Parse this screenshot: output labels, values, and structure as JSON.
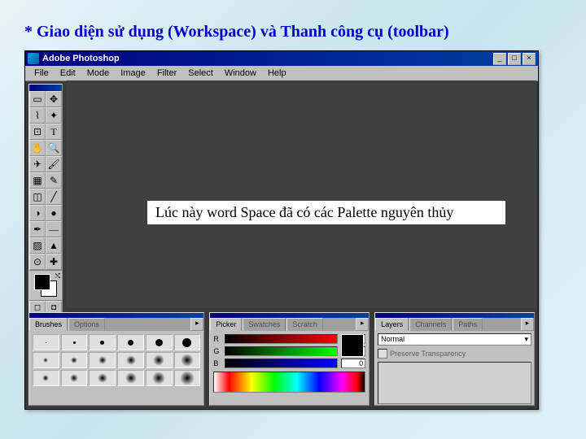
{
  "slide": {
    "title": "* Giao diện sử dụng (Workspace) và Thanh công cụ (toolbar)"
  },
  "app": {
    "title": "Adobe Photoshop",
    "menu": [
      "File",
      "Edit",
      "Mode",
      "Image",
      "Filter",
      "Select",
      "Window",
      "Help"
    ],
    "callout": "Lúc này word Space đã có các Palette nguyên thủy"
  },
  "titlebar_buttons": {
    "min": "_",
    "max": "□",
    "close": "×"
  },
  "tools": [
    "marquee",
    "move",
    "lasso",
    "wand",
    "crop",
    "type",
    "hand",
    "zoom",
    "airbrush",
    "brush",
    "stamp",
    "pencil",
    "eraser",
    "line",
    "blur",
    "dodge",
    "pen",
    "measure",
    "gradient",
    "bucket",
    "eyedropper",
    "notes"
  ],
  "tool_glyphs": [
    "▭",
    "✥",
    "⌇",
    "✦",
    "⊡",
    "T",
    "✋",
    "🔍",
    "✈",
    "🖌",
    "▦",
    "✎",
    "◫",
    "╱",
    "◑",
    "●",
    "✒",
    "—",
    "▨",
    "▲",
    "⊙",
    "✚"
  ],
  "modes": {
    "std": "◻",
    "qmask": "◘",
    "screen1": "▭",
    "screen2": "▣"
  },
  "panels": {
    "brushes": {
      "tabs": [
        "Brushes",
        "Options"
      ],
      "sizes_hard": [
        1,
        3,
        5,
        7,
        9,
        11
      ],
      "sizes_soft": [
        6,
        8,
        10,
        12,
        14,
        16
      ],
      "sizes_soft2": [
        8,
        10,
        12,
        14,
        16,
        18
      ]
    },
    "picker": {
      "tabs": [
        "Picker",
        "Swatches",
        "Scratch"
      ],
      "sliders": [
        {
          "label": "R",
          "val": "0",
          "grad": "linear-gradient(to right,#000,#f00)"
        },
        {
          "label": "G",
          "val": "0",
          "grad": "linear-gradient(to right,#000,#0f0)"
        },
        {
          "label": "B",
          "val": "0",
          "grad": "linear-gradient(to right,#000,#00f)"
        }
      ]
    },
    "layers": {
      "tabs": [
        "Layers",
        "Channels",
        "Paths"
      ],
      "mode": "Normal",
      "preserve": "Preserve Transparency"
    }
  }
}
